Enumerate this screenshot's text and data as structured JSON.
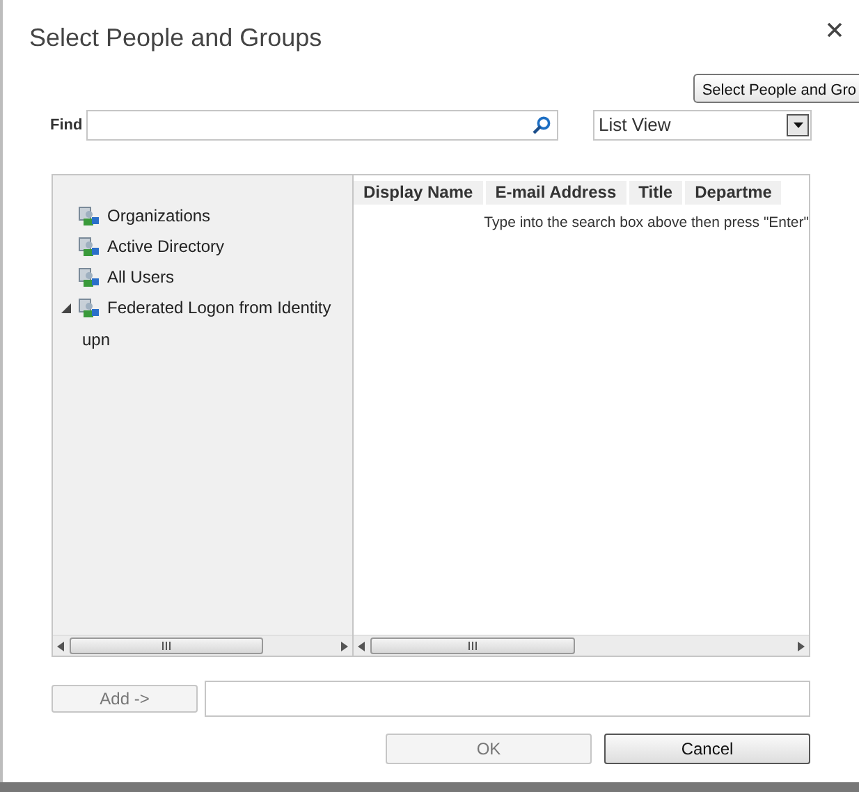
{
  "dialog": {
    "title": "Select People and Groups",
    "tooltip": "Select People and Gro"
  },
  "find": {
    "label": "Find"
  },
  "view_select": {
    "value": "List View"
  },
  "tree": [
    {
      "label": "Organizations"
    },
    {
      "label": "Active Directory"
    },
    {
      "label": "All Users"
    },
    {
      "label": "Federated Logon from Identity",
      "expanded": true,
      "children": [
        {
          "label": "upn"
        }
      ]
    }
  ],
  "table": {
    "columns": [
      "Display Name",
      "E-mail Address",
      "Title",
      "Departme"
    ],
    "message": "Type into the search box above then press \"Enter\""
  },
  "add_button": {
    "label": "Add ->",
    "disabled": true
  },
  "buttons": [
    {
      "label": "OK",
      "disabled": true
    },
    {
      "label": "Cancel",
      "disabled": false
    }
  ]
}
